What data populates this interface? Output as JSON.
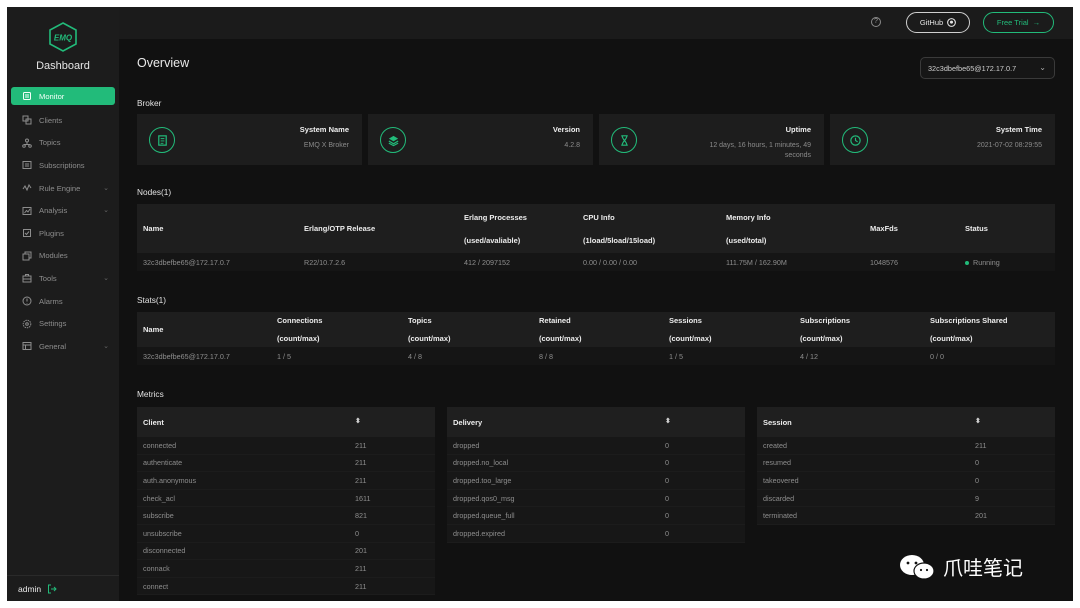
{
  "sidebar": {
    "logo_text": "EMQ",
    "brand": "Dashboard",
    "items": [
      {
        "label": "Monitor",
        "icon": "monitor-icon",
        "active": true
      },
      {
        "label": "Clients",
        "icon": "clients-icon"
      },
      {
        "label": "Topics",
        "icon": "topics-icon"
      },
      {
        "label": "Subscriptions",
        "icon": "subscriptions-icon"
      },
      {
        "label": "Rule Engine",
        "icon": "rule-engine-icon",
        "expandable": true
      },
      {
        "label": "Analysis",
        "icon": "analysis-icon",
        "expandable": true
      },
      {
        "label": "Plugins",
        "icon": "plugins-icon"
      },
      {
        "label": "Modules",
        "icon": "modules-icon"
      },
      {
        "label": "Tools",
        "icon": "tools-icon",
        "expandable": true
      },
      {
        "label": "Alarms",
        "icon": "alarm-icon"
      },
      {
        "label": "Settings",
        "icon": "settings-icon"
      },
      {
        "label": "General",
        "icon": "general-icon",
        "expandable": true
      }
    ],
    "user": "admin"
  },
  "header": {
    "help": "?",
    "github_label": "GitHub",
    "trial_label": "Free Trial"
  },
  "page": {
    "title": "Overview",
    "node_selected": "32c3dbefbe65@172.17.0.7"
  },
  "broker": {
    "title": "Broker",
    "cards": [
      {
        "label": "System Name",
        "value": "EMQ X Broker",
        "icon": "document-icon"
      },
      {
        "label": "Version",
        "value": "4.2.8",
        "icon": "layers-icon"
      },
      {
        "label": "Uptime",
        "value": "12 days, 16 hours, 1 minutes, 49 seconds",
        "icon": "hourglass-icon"
      },
      {
        "label": "System Time",
        "value": "2021-07-02 08:29:55",
        "icon": "clock-icon"
      }
    ]
  },
  "nodes": {
    "title": "Nodes(1)",
    "headers": {
      "name": "Name",
      "release": "Erlang/OTP Release",
      "processes": "Erlang Processes",
      "processes_sub": "(used/avaliable)",
      "cpu": "CPU Info",
      "cpu_sub": "(1load/5load/15load)",
      "memory": "Memory Info",
      "memory_sub": "(used/total)",
      "maxfds": "MaxFds",
      "status": "Status"
    },
    "row": {
      "name": "32c3dbefbe65@172.17.0.7",
      "release": "R22/10.7.2.6",
      "processes": "412 / 2097152",
      "cpu": "0.00 / 0.00 / 0.00",
      "memory": "111.75M / 162.90M",
      "maxfds": "1048576",
      "status": "Running"
    }
  },
  "stats": {
    "title": "Stats(1)",
    "headers": {
      "name": "Name",
      "connections": "Connections",
      "topics": "Topics",
      "retained": "Retained",
      "sessions": "Sessions",
      "subscriptions": "Subscriptions",
      "subscriptions_shared": "Subscriptions Shared",
      "sub": "(count/max)"
    },
    "row": {
      "name": "32c3dbefbe65@172.17.0.7",
      "connections": "1 / 5",
      "topics": "4 / 8",
      "retained": "8 / 8",
      "sessions": "1 / 5",
      "subscriptions": "4 / 12",
      "subscriptions_shared": "0 / 0"
    }
  },
  "metrics": {
    "title": "Metrics",
    "sort_glyph": "⬍",
    "client": {
      "header": "Client",
      "rows": [
        {
          "k": "connected",
          "v": "211"
        },
        {
          "k": "authenticate",
          "v": "211"
        },
        {
          "k": "auth.anonymous",
          "v": "211"
        },
        {
          "k": "check_acl",
          "v": "1611"
        },
        {
          "k": "subscribe",
          "v": "821"
        },
        {
          "k": "unsubscribe",
          "v": "0"
        },
        {
          "k": "disconnected",
          "v": "201"
        },
        {
          "k": "connack",
          "v": "211"
        },
        {
          "k": "connect",
          "v": "211"
        }
      ]
    },
    "delivery": {
      "header": "Delivery",
      "rows": [
        {
          "k": "dropped",
          "v": "0"
        },
        {
          "k": "dropped.no_local",
          "v": "0"
        },
        {
          "k": "dropped.too_large",
          "v": "0"
        },
        {
          "k": "dropped.qos0_msg",
          "v": "0"
        },
        {
          "k": "dropped.queue_full",
          "v": "0"
        },
        {
          "k": "dropped.expired",
          "v": "0"
        }
      ]
    },
    "session": {
      "header": "Session",
      "rows": [
        {
          "k": "created",
          "v": "211"
        },
        {
          "k": "resumed",
          "v": "0"
        },
        {
          "k": "takeovered",
          "v": "0"
        },
        {
          "k": "discarded",
          "v": "9"
        },
        {
          "k": "terminated",
          "v": "201"
        }
      ]
    }
  },
  "watermark": {
    "text": "爪哇笔记"
  },
  "colors": {
    "accent": "#22bb7a",
    "background": "#111111",
    "panel": "#1d1d1d"
  }
}
